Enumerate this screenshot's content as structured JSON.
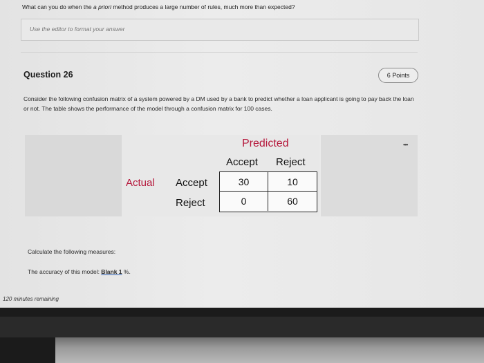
{
  "previous_question": {
    "text_before": "What can you do when the ",
    "text_italic": "a priori",
    "text_after": " method produces a large number of rules, much more than expected?"
  },
  "editor": {
    "placeholder": "Use the editor to format your answer"
  },
  "question": {
    "title": "Question 26",
    "points": "6 Points",
    "description": "Consider the following confusion matrix of a system powered by a DM used by a bank to predict whether a loan applicant is going to pay back the loan or not. The table shows the performance of the model through a confusion matrix for 100 cases."
  },
  "figure": {
    "more_icon": "•••",
    "predicted_label": "Predicted",
    "col_headers": [
      "Accept",
      "Reject"
    ],
    "actual_label": "Actual",
    "row_headers": [
      "Accept",
      "Reject"
    ],
    "matrix": [
      [
        "30",
        "10"
      ],
      [
        "0",
        "60"
      ]
    ]
  },
  "prompt": "Calculate the following measures:",
  "accuracy": {
    "label": "The accuracy of this model: ",
    "blank": "Blank 1",
    "suffix": " %."
  },
  "timer": "120 minutes remaining",
  "colors": {
    "accent_red": "#b5163a"
  }
}
